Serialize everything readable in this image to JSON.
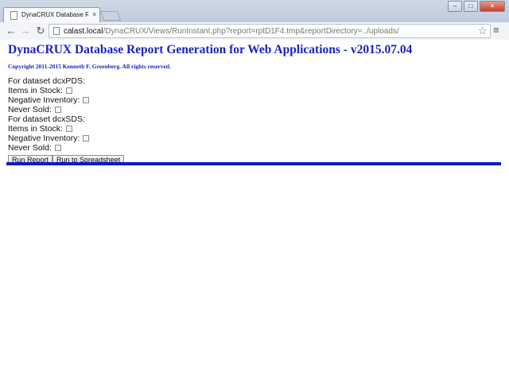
{
  "browser": {
    "tab_title": "DynaCRUX Database Rep",
    "tab_close": "×",
    "url_host": "calast.local",
    "url_path": "/DynaCRUX/Views/RunInstant.php?report=rptD1F4.tmp&reportDirectory=../uploads/",
    "icons": {
      "back": "back-arrow-icon",
      "forward": "forward-arrow-icon",
      "reload": "reload-icon",
      "bookmark": "star-icon",
      "menu": "hamburger-menu-icon"
    }
  },
  "page": {
    "title": "DynaCRUX Database Report Generation for Web Applications - v2015.07.04",
    "copyright": "Copyright 2011-2015 Kenneth F. Greenberg. All rights reserved."
  },
  "datasets": [
    {
      "heading": "For dataset dcxPDS:",
      "options": [
        {
          "label": "Items in Stock:",
          "checked": false
        },
        {
          "label": "Negative Inventory:",
          "checked": false
        },
        {
          "label": "Never Sold:",
          "checked": false
        }
      ]
    },
    {
      "heading": "For dataset dcxSDS:",
      "options": [
        {
          "label": "Items in Stock:",
          "checked": false
        },
        {
          "label": "Negative Inventory:",
          "checked": false
        },
        {
          "label": "Never Sold:",
          "checked": false
        }
      ]
    }
  ],
  "buttons": {
    "run_report": "Run Report",
    "run_spreadsheet": "Run to Spreadsheet"
  },
  "colors": {
    "heading": "#1a22c8",
    "rule": "#0e1ac8"
  }
}
